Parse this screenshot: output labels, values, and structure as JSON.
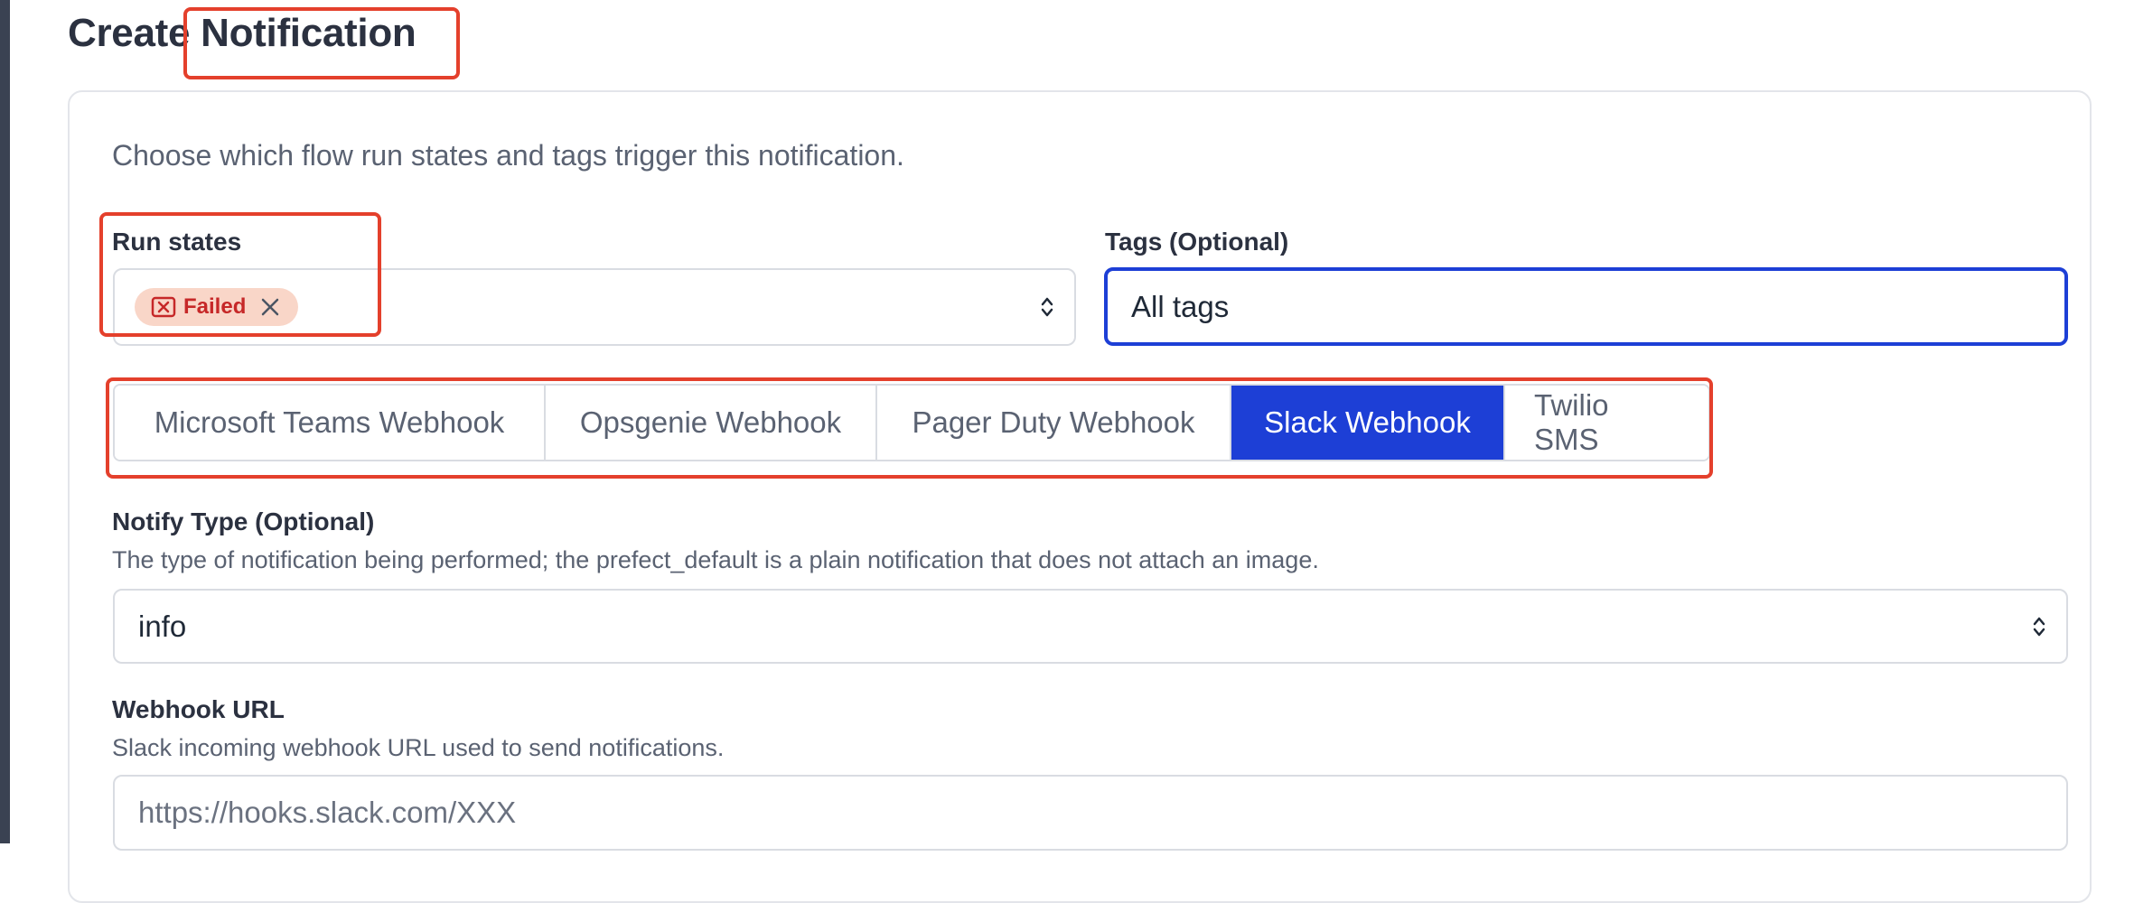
{
  "header": {
    "title_prefix": "Create",
    "title_highlight": "Notification"
  },
  "form": {
    "intro": "Choose which flow run states and tags trigger this notification.",
    "run_states": {
      "label": "Run states",
      "selected_chip": "Failed"
    },
    "tags": {
      "label": "Tags (Optional)",
      "placeholder": "All tags"
    },
    "tabs": [
      {
        "label": "Microsoft Teams Webhook"
      },
      {
        "label": "Opsgenie Webhook"
      },
      {
        "label": "Pager Duty Webhook"
      },
      {
        "label": "Slack Webhook"
      },
      {
        "label": "Twilio SMS"
      }
    ],
    "active_tab": "Slack Webhook",
    "notify_type": {
      "label": "Notify Type (Optional)",
      "help": "The type of notification being performed; the prefect_default is a plain notification that does not attach an image.",
      "value": "info"
    },
    "webhook_url": {
      "label": "Webhook URL",
      "help": "Slack incoming webhook URL used to send notifications.",
      "placeholder": "https://hooks.slack.com/XXX"
    }
  },
  "colors": {
    "accent": "#1d3fd6",
    "highlight_box": "#e4402c",
    "failed_chip_bg": "#f9d6c8",
    "failed_chip_text": "#c62828",
    "left_rail": "#3a4252"
  },
  "icons": {
    "chip_status": "x-square-icon",
    "chip_remove": "close-icon",
    "select_toggle": "chevron-up-down-icon"
  }
}
